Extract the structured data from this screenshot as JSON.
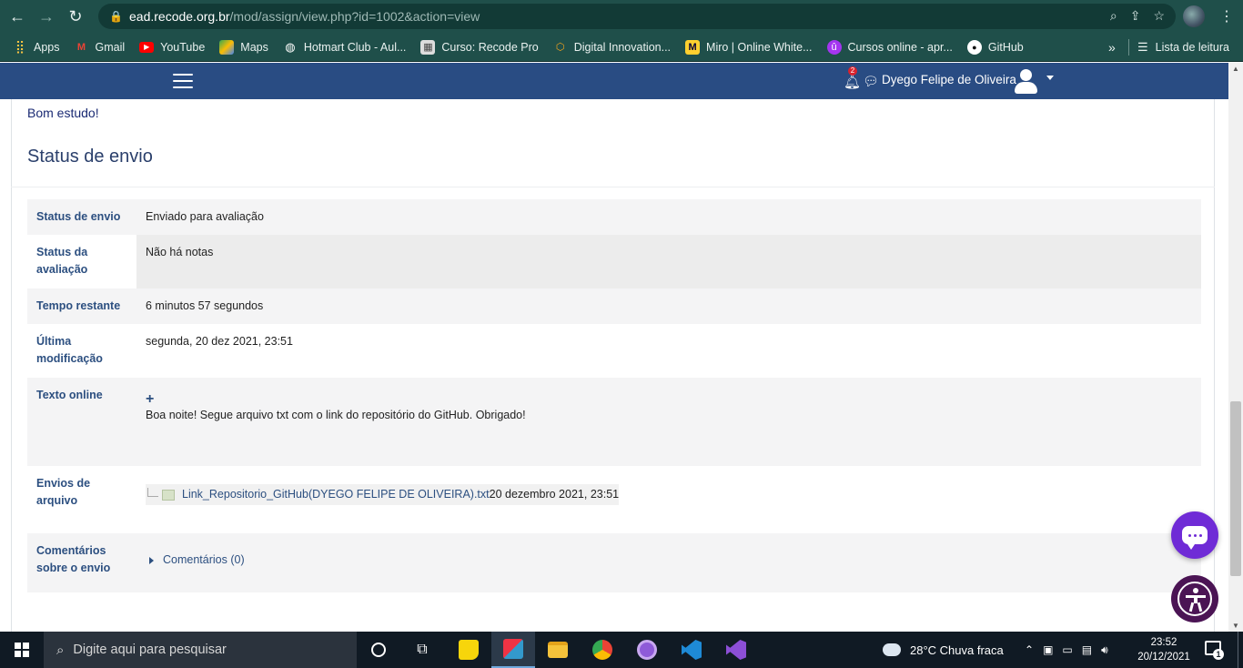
{
  "browser": {
    "url_host": "ead.recode.org.br",
    "url_path": "/mod/assign/view.php?id=1002&action=view",
    "bookmarks": [
      "Apps",
      "Gmail",
      "YouTube",
      "Maps",
      "Hotmart Club - Aul...",
      "Curso: Recode Pro",
      "Digital Innovation...",
      "Miro | Online White...",
      "Cursos online - apr...",
      "GitHub"
    ],
    "more": "»",
    "reading_list": "Lista de leitura"
  },
  "navbar": {
    "notification_count": "2",
    "user_name": "Dyego Felipe de Oliveira"
  },
  "main": {
    "intro": "Bom estudo!",
    "section_title": "Status de envio",
    "rows": [
      {
        "label": "Status de envio",
        "value": "Enviado para avaliação"
      },
      {
        "label": "Status da avaliação",
        "value": "Não há notas"
      },
      {
        "label": "Tempo restante",
        "value": "6 minutos 57 segundos"
      },
      {
        "label": "Última modificação",
        "value": "segunda, 20 dez 2021, 23:51"
      },
      {
        "label": "Texto online",
        "value": "Boa noite! Segue arquivo txt com o link do repositório do GitHub. Obrigado!"
      },
      {
        "label": "Envios de arquivo",
        "file_name": "Link_Repositorio_GitHub(DYEGO FELIPE DE OLIVEIRA).txt",
        "file_date": "20 dezembro 2021, 23:51"
      },
      {
        "label": "Comentários sobre o envio",
        "value": "Comentários (0)"
      }
    ]
  },
  "taskbar": {
    "search_placeholder": "Digite aqui para pesquisar",
    "weather": "28°C  Chuva fraca",
    "time": "23:52",
    "date": "20/12/2021",
    "notification_count": "1"
  }
}
